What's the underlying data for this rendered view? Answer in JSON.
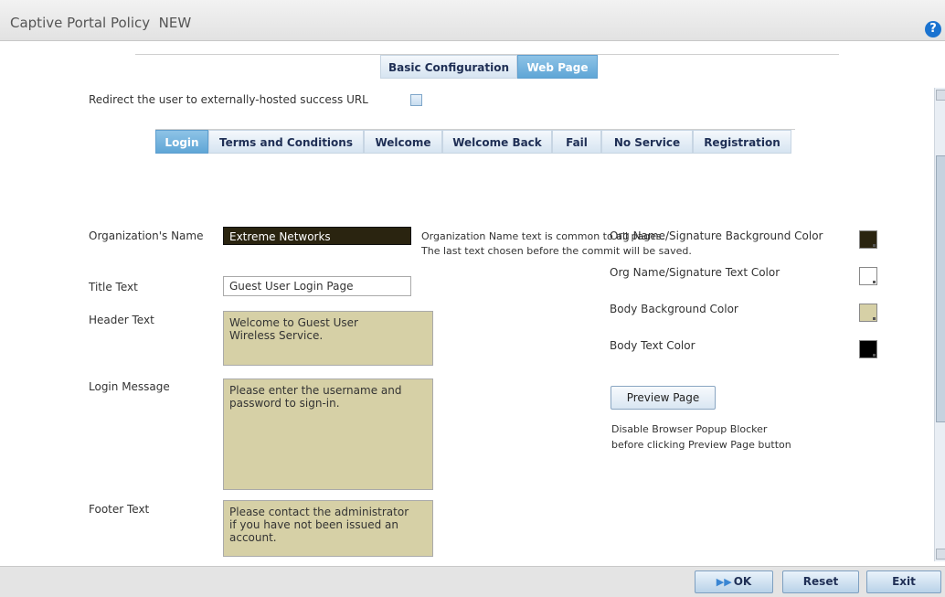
{
  "window": {
    "title": "Captive Portal Policy  NEW"
  },
  "top_tabs": [
    {
      "label": "Basic Configuration",
      "active": false
    },
    {
      "label": "Web Page",
      "active": true
    }
  ],
  "redirect": {
    "label": "Redirect the user to externally-hosted success URL",
    "checked": false
  },
  "sub_tabs": [
    {
      "label": "Login",
      "active": true
    },
    {
      "label": "Terms and Conditions",
      "active": false
    },
    {
      "label": "Welcome",
      "active": false
    },
    {
      "label": "Welcome Back",
      "active": false
    },
    {
      "label": "Fail",
      "active": false
    },
    {
      "label": "No Service",
      "active": false
    },
    {
      "label": "Registration",
      "active": false
    }
  ],
  "form": {
    "org_name": {
      "label": "Organization's Name",
      "value": "Extreme  Networks"
    },
    "title_text": {
      "label": "Title Text",
      "value": "Guest User Login Page"
    },
    "header_text": {
      "label": "Header Text",
      "value": "Welcome to Guest User\nWireless Service."
    },
    "login_message": {
      "label": "Login Message",
      "value": "Please enter the username and\npassword to sign-in."
    },
    "footer_text": {
      "label": "Footer Text",
      "value": "Please contact the administrator\nif you have not been issued an\naccount."
    },
    "org_note": "Organization Name text is common to all pages.\nThe last text chosen before the commit will be saved."
  },
  "colors": [
    {
      "label": "Org Name/Signature Background Color",
      "value": "#2a2410"
    },
    {
      "label": "Org Name/Signature Text Color",
      "value": "#ffffff"
    },
    {
      "label": "Body Background Color",
      "value": "#d6d0a6"
    },
    {
      "label": "Body Text Color",
      "value": "#000000"
    }
  ],
  "preview": {
    "button_label": "Preview Page",
    "note": "Disable Browser Popup Blocker\nbefore clicking Preview Page button"
  },
  "footer_buttons": {
    "ok": "OK",
    "reset": "Reset",
    "exit": "Exit"
  },
  "icons": {
    "help": "help-icon",
    "ok": "double-arrow-right-icon"
  }
}
